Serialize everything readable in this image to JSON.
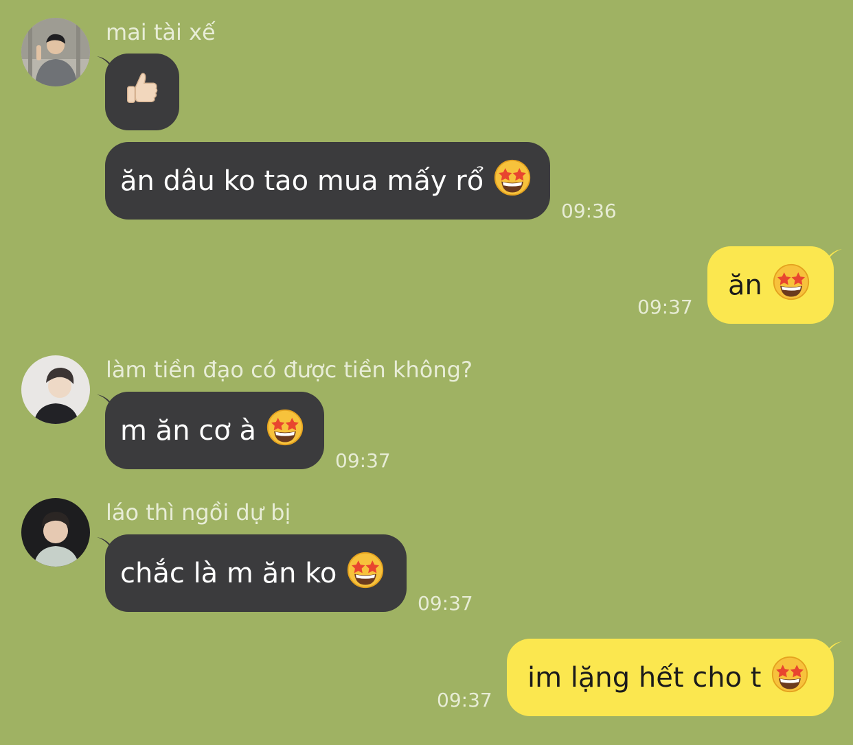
{
  "messages": [
    {
      "sender": "mai tài xế",
      "text": "",
      "emoji": "thumbs-up",
      "time": ""
    },
    {
      "sender": "",
      "text": "ăn dâu ko tao mua mấy rổ",
      "emoji": "star-struck",
      "time": "09:36"
    },
    {
      "sender": "",
      "text": "ăn",
      "emoji": "star-struck",
      "time": "09:37"
    },
    {
      "sender": "làm tiền đạo có được tiền không?",
      "text": "m ăn cơ à",
      "emoji": "star-struck",
      "time": "09:37"
    },
    {
      "sender": "láo thì ngồi dự bị",
      "text": "chắc là m ăn ko",
      "emoji": "star-struck",
      "time": "09:37"
    },
    {
      "sender": "",
      "text": "im lặng hết cho t",
      "emoji": "star-struck",
      "time": "09:37"
    }
  ],
  "colors": {
    "background": "#9fb263",
    "incoming_bubble": "#3b3b3d",
    "outgoing_bubble": "#fbe74f",
    "sender_text": "#e8edd7",
    "timestamp": "#e7ecd5"
  }
}
